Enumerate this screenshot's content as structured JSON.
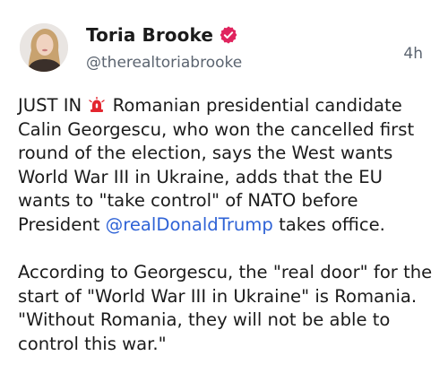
{
  "author": {
    "display_name": "Toria Brooke",
    "handle": "@therealtoriabrooke",
    "avatar_icon": "profile-photo",
    "verified_icon": "verified-badge-icon",
    "verified_color": "#e0245e"
  },
  "post": {
    "timestamp": "4h",
    "p1_part1": "JUST IN",
    "p1_emoji_icon": "siren-icon",
    "p1_part2": "Romanian presidential candidate Calin Georgescu, who won the cancelled first round of the election, says the West wants World War III in Ukraine, adds that the EU wants to \"take control\" of NATO before President",
    "p1_mention": "@realDonaldTrump",
    "p1_part3": "takes office.",
    "p2": "According to Georgescu, the \"real door\" for the start of \"World War III in Ukraine\" is Romania. \"Without Romania, they will not be able to control this war.\""
  },
  "colors": {
    "text": "#1b1b1b",
    "secondary": "#5b6470",
    "mention": "#2f63d6",
    "siren": "#e3262f"
  }
}
